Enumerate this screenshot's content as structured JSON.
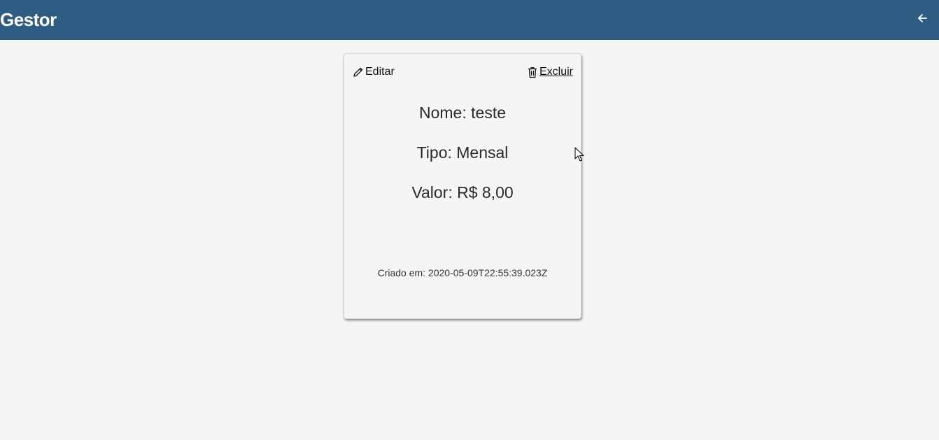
{
  "header": {
    "title": "Gestor",
    "back_icon": "arrow-left-icon",
    "bg_color": "#2e5c82"
  },
  "card": {
    "edit_label": "Editar",
    "delete_label": "Excluir",
    "name_line": "Nome: teste",
    "type_line": "Tipo: Mensal",
    "value_line": "Valor: R$ 8,00",
    "created_line": "Criado em: 2020-05-09T22:55:39.023Z",
    "edit_icon": "pencil-icon",
    "delete_icon": "trash-icon"
  }
}
